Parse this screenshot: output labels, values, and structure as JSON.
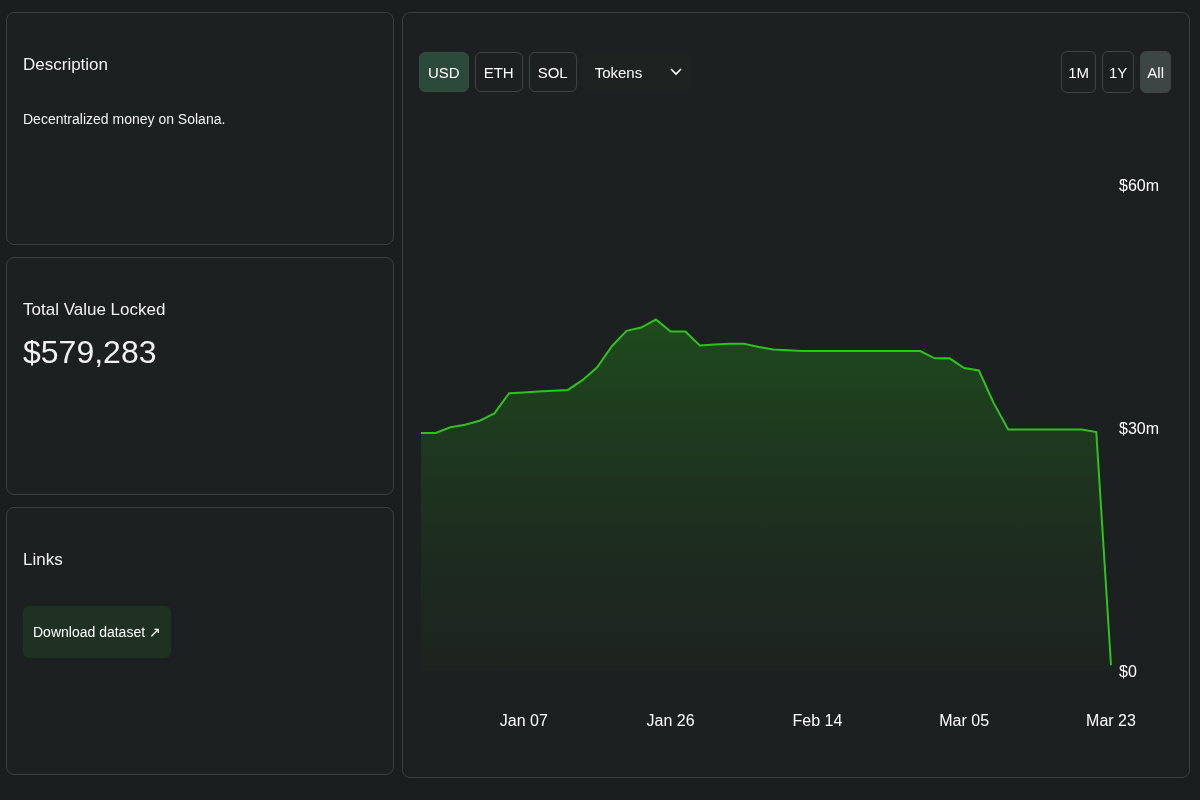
{
  "description_card": {
    "title": "Description",
    "text": "Decentralized money on Solana."
  },
  "tvl_card": {
    "title": "Total Value Locked",
    "value": "$579,283"
  },
  "links_card": {
    "title": "Links",
    "links": [
      {
        "label": "Download dataset ↗"
      }
    ]
  },
  "chart_panel": {
    "currencies": [
      {
        "label": "USD",
        "selected": true
      },
      {
        "label": "ETH",
        "selected": false
      },
      {
        "label": "SOL",
        "selected": false
      }
    ],
    "dropdown": {
      "label": "Tokens"
    },
    "ranges": [
      {
        "label": "1M",
        "selected": false
      },
      {
        "label": "1Y",
        "selected": false
      },
      {
        "label": "All",
        "selected": true
      }
    ],
    "chart_data": {
      "type": "area",
      "categories": [
        null,
        null,
        null,
        null,
        null,
        null,
        null,
        "Jan 07",
        null,
        null,
        null,
        null,
        null,
        null,
        null,
        null,
        null,
        "Jan 26",
        null,
        null,
        null,
        null,
        null,
        null,
        null,
        null,
        null,
        "Feb 14",
        null,
        null,
        null,
        null,
        null,
        null,
        null,
        null,
        null,
        "Mar 05",
        null,
        null,
        null,
        null,
        null,
        null,
        null,
        null,
        null,
        "Mar 23"
      ],
      "series": [
        {
          "color": "#2fc21f",
          "values": [
            29.4,
            29.4,
            30.1,
            30.4,
            30.9,
            31.8,
            34.3,
            34.4,
            34.5,
            34.6,
            34.7,
            35.9,
            37.5,
            40.1,
            42.0,
            42.4,
            43.4,
            41.9,
            41.9,
            40.2,
            40.3,
            40.4,
            40.4,
            40.0,
            39.7,
            39.6,
            39.5,
            39.5,
            39.5,
            39.5,
            39.5,
            39.5,
            39.5,
            39.5,
            39.5,
            38.6,
            38.6,
            37.4,
            37.1,
            33.1,
            29.8,
            29.8,
            29.8,
            29.8,
            29.8,
            29.8,
            29.5,
            0.7
          ]
        }
      ],
      "ylim": [
        0,
        60
      ],
      "yticks": [
        {
          "value": 60,
          "label": "$60m"
        },
        {
          "value": 30,
          "label": "$30m"
        },
        {
          "value": 0,
          "label": "$0"
        }
      ]
    }
  }
}
